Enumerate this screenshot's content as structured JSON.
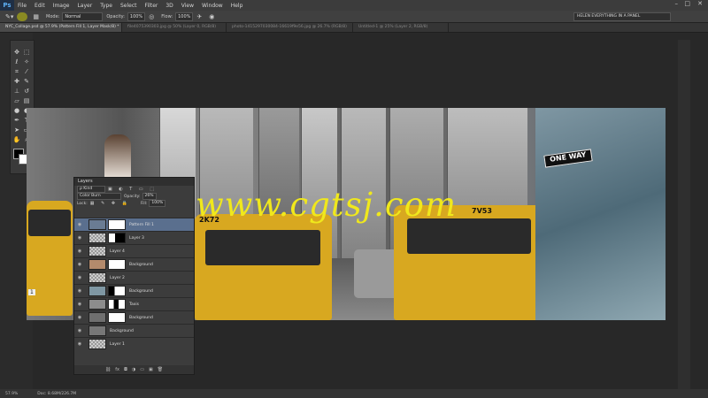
{
  "app": {
    "logo": "Ps"
  },
  "menu": [
    "File",
    "Edit",
    "Image",
    "Layer",
    "Type",
    "Select",
    "Filter",
    "3D",
    "View",
    "Window",
    "Help"
  ],
  "window_controls": {
    "minimize": "–",
    "maximize": "□",
    "close": "✕"
  },
  "options_bar": {
    "mode_label": "Mode:",
    "mode_value": "Normal",
    "opacity_label": "Opacity:",
    "opacity_value": "100%",
    "flow_label": "Flow:",
    "flow_value": "100%",
    "workspace": "HELEN EVERYTHING IN A PANEL"
  },
  "doc_tabs": [
    "NYC_Collage.psd @ 57.9% (Pattern Fill 1, Layer Mask/8) *",
    "file4075390303.jpg @ 50% (Layer 0, RGB/8)",
    "photo-1415297030084-16619f9e56.jpg @ 26.7% (RGB/8)",
    "Untitled-1 @ 25% (Layer 2, RGB/8)"
  ],
  "canvas": {
    "watermark": "www.cgtsj.com",
    "sign_text": "ONE WAY",
    "taxi_numbers": [
      "1",
      "2K72",
      "7V53"
    ]
  },
  "layers_panel": {
    "title": "Layers",
    "kind_label": "ρ Kind",
    "blend_mode": "Color Burn",
    "opacity_label": "Opacity:",
    "opacity_value": "26%",
    "lock_label": "Lock:",
    "fill_label": "Fill:",
    "fill_value": "100%",
    "layers": [
      {
        "name": "Pattern Fill 1",
        "selected": true
      },
      {
        "name": "Layer 3",
        "selected": false
      },
      {
        "name": "Layer 4",
        "selected": false
      },
      {
        "name": "Background",
        "selected": false
      },
      {
        "name": "Layer 2",
        "selected": false
      },
      {
        "name": "Background",
        "selected": false
      },
      {
        "name": "Taxis",
        "selected": false
      },
      {
        "name": "Background",
        "selected": false
      },
      {
        "name": "Background",
        "selected": false
      },
      {
        "name": "Layer 1",
        "selected": false
      }
    ],
    "footer_icons": [
      "link-icon",
      "fx-icon",
      "mask-icon",
      "adjustment-icon",
      "folder-icon",
      "new-layer-icon",
      "trash-icon"
    ],
    "footer_glyphs": [
      "⛓",
      "fx",
      "◘",
      "◑",
      "▭",
      "▣",
      "🗑"
    ]
  },
  "status": {
    "zoom": "57.9%",
    "doc": "Doc: 8.68M/226.7M"
  },
  "colors": {
    "accent": "#f0e81c",
    "panel": "#3c3c3c",
    "selection": "#5a6f8e"
  }
}
